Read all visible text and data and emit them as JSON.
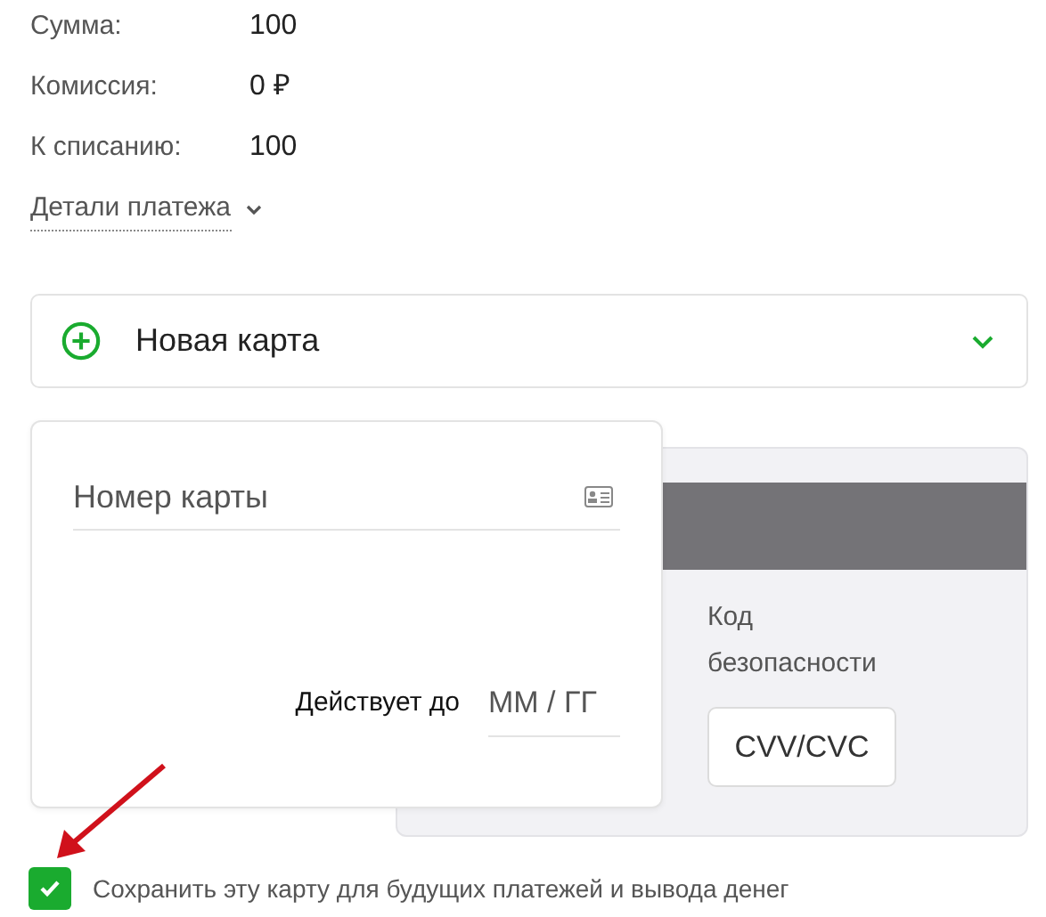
{
  "summary": [
    {
      "label": "Сумма:",
      "value": "100"
    },
    {
      "label": "Комиссия:",
      "value": "0 ₽"
    },
    {
      "label": "К списанию:",
      "value": "100"
    }
  ],
  "details_link": {
    "label": "Детали платежа",
    "expanded": false
  },
  "new_card": {
    "title": "Новая карта",
    "expanded": true
  },
  "card_front": {
    "number_placeholder": "Номер карты",
    "expiry_label": "Действует до",
    "expiry_placeholder": "ММ / ГГ"
  },
  "card_back": {
    "cvv_label": "Код безопасности",
    "cvv_placeholder": "CVV/CVC"
  },
  "save_card": {
    "label": "Сохранить эту карту для будущих платежей и вывода денег",
    "checked": true
  }
}
